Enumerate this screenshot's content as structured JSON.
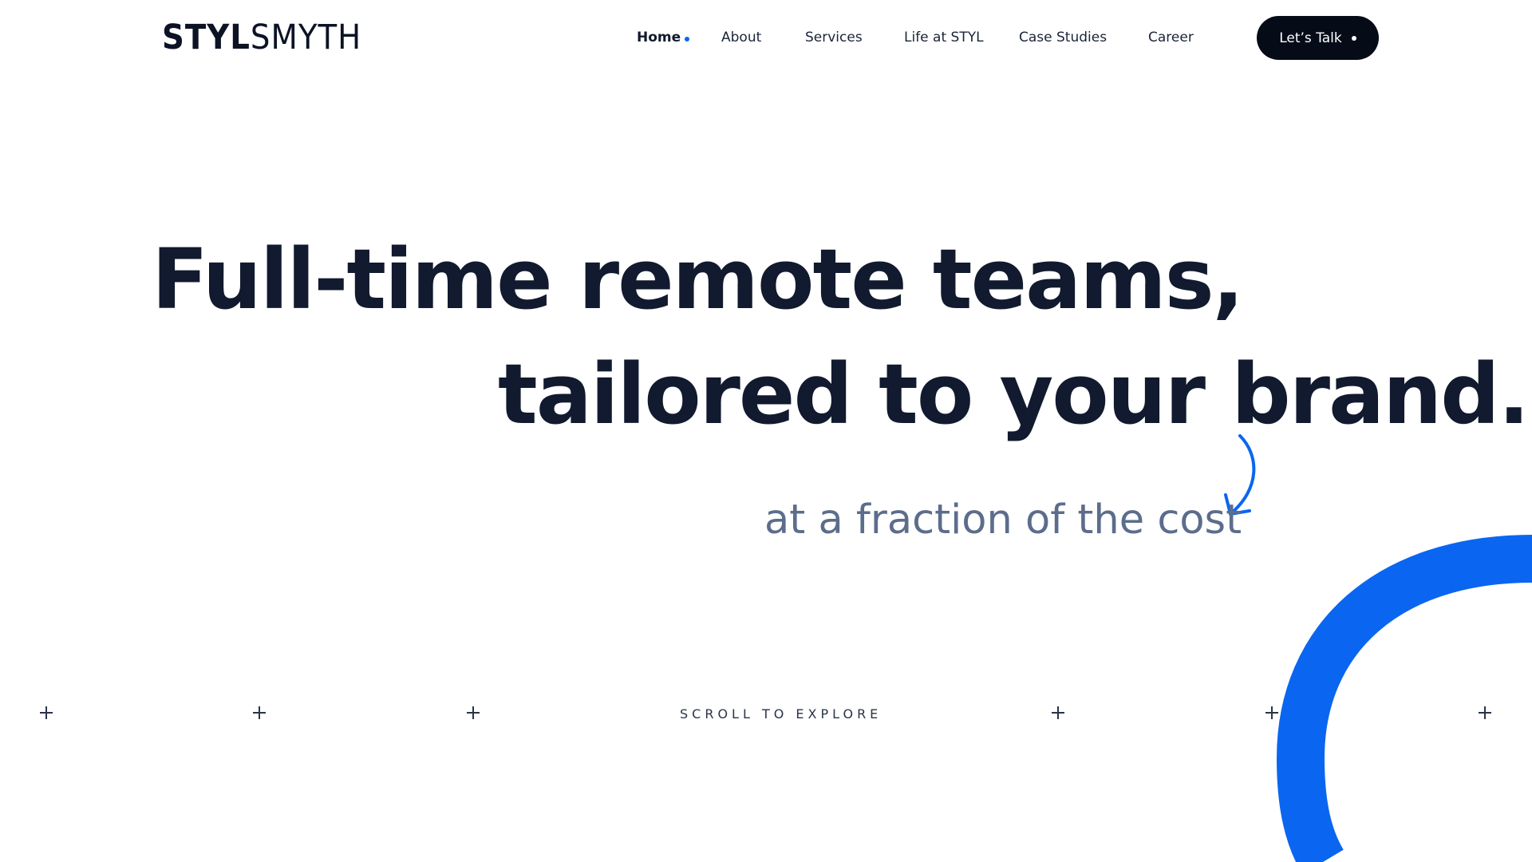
{
  "header": {
    "logo_bold": "STYL",
    "logo_light": "SMYTH",
    "nav": {
      "home": "Home",
      "about": "About",
      "services": "Services",
      "life": "Life at STYL",
      "case_studies": "Case Studies",
      "career": "Career"
    },
    "cta_label": "Let’s Talk"
  },
  "hero": {
    "line1": "Full-time remote teams,",
    "line2": "tailored to your brand.",
    "subtitle": "at a fraction of the cost"
  },
  "scroll_label": "SCROLL TO EXPLORE",
  "colors": {
    "accent": "#0a66f0",
    "text_dark": "#111a2e",
    "subtitle": "#5c6d8c",
    "button_bg": "#060b18"
  },
  "icons": {
    "nav_active_dot": "dot-icon",
    "cta_dot": "dot-icon",
    "curved_arrow": "curved-arrow-icon",
    "plus_markers": "plus-icon"
  }
}
